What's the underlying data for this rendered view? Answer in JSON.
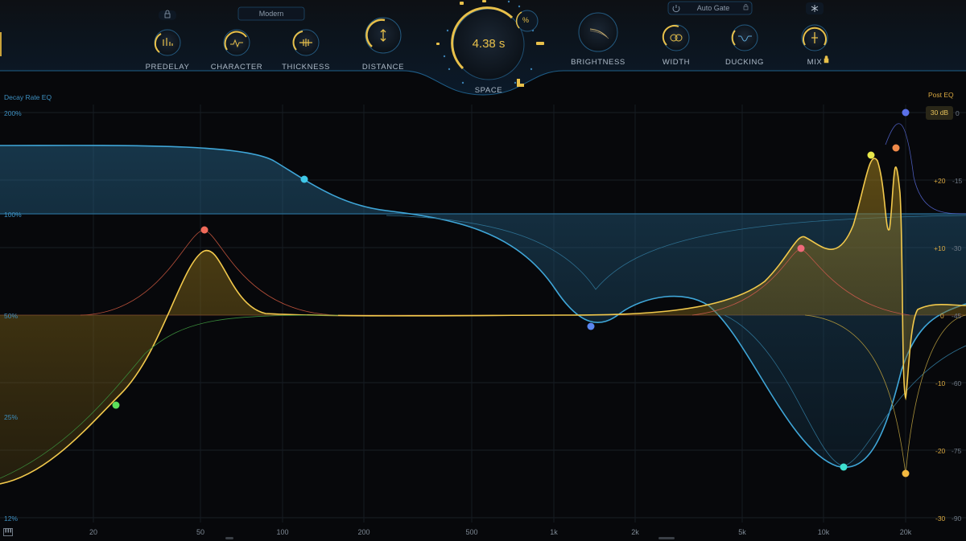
{
  "header": {
    "character_preset": "Modern",
    "auto_gate_label": "Auto Gate",
    "knobs": {
      "predelay": "PREDELAY",
      "character": "CHARACTER",
      "thickness": "THICKNESS",
      "distance": "DISTANCE",
      "space": "SPACE",
      "space_value": "4.38 s",
      "space_unit_toggle": "%",
      "brightness": "BRIGHTNESS",
      "width": "WIDTH",
      "ducking": "DUCKING",
      "mix": "MIX"
    },
    "icons": [
      "lock-icon",
      "power-icon",
      "snowflake-icon",
      "lock-icon"
    ]
  },
  "eq": {
    "left_title": "Decay Rate EQ",
    "right_title": "Post EQ",
    "db_range": "30 dB",
    "left_scale": [
      "200%",
      "100%",
      "50%",
      "25%",
      "12%"
    ],
    "right_db_scale": [
      "+20",
      "+10",
      "0",
      "-10",
      "-20",
      "-30"
    ],
    "right_pct_scale": [
      "0",
      "-15",
      "-30",
      "-45",
      "-60",
      "-75",
      "-90"
    ],
    "freq_labels": [
      "20",
      "50",
      "100",
      "200",
      "500",
      "1k",
      "2k",
      "5k",
      "10k",
      "20k"
    ],
    "colors": {
      "decay_curve": "#3fa6d8",
      "post_curve": "#f2c94c",
      "node_cyan": "#3fc8e8",
      "node_red": "#f06a5a",
      "node_green": "#5be05b",
      "node_blue": "#5a86f0",
      "node_teal": "#3ee0d0",
      "node_yellow": "#e8e84a",
      "node_orange": "#f08a4a",
      "node_gold": "#f2b840",
      "node_indigo": "#5a70e8"
    }
  }
}
